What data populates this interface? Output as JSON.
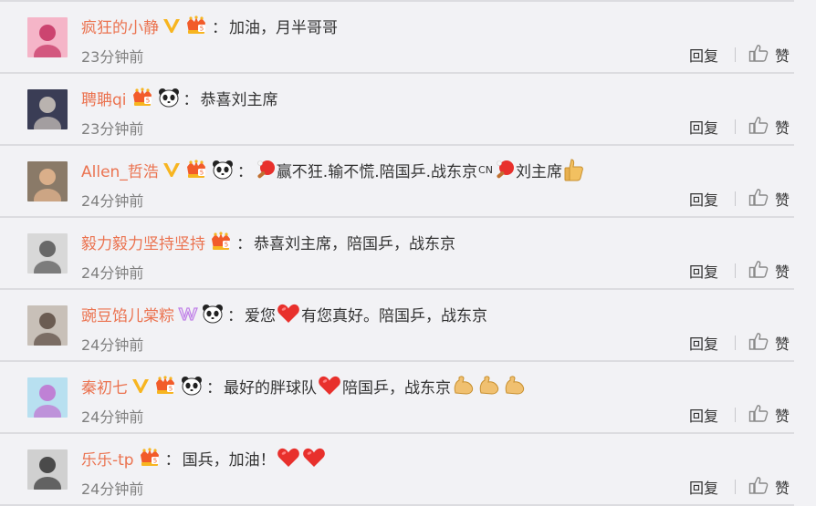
{
  "comments": [
    {
      "name": "疯狂的小静",
      "badges": [
        "v-gold",
        "crown"
      ],
      "parts": [
        {
          "t": "text",
          "v": "加油，月半哥哥"
        }
      ],
      "time": "23分钟前",
      "avatar": {
        "bg": "#f5b5c8",
        "fg": "#c43060"
      }
    },
    {
      "name": "聘聃qi",
      "badges": [
        "crown",
        "panda"
      ],
      "parts": [
        {
          "t": "text",
          "v": "恭喜刘主席"
        }
      ],
      "time": "23分钟前",
      "avatar": {
        "bg": "#3a3d55",
        "fg": "#d0c8c0"
      }
    },
    {
      "name": "Allen_哲浩",
      "badges": [
        "v-gold",
        "crown",
        "panda"
      ],
      "parts": [
        {
          "t": "icon",
          "v": "pingpong-icon"
        },
        {
          "t": "text",
          "v": "赢不狂.输不慌.陪国乒.战东京"
        },
        {
          "t": "text",
          "v": "CN",
          "small": true
        },
        {
          "t": "icon",
          "v": "pingpong-icon"
        },
        {
          "t": "text",
          "v": "刘主席"
        },
        {
          "t": "icon",
          "v": "thumbs-up-emoji-icon"
        }
      ],
      "time": "24分钟前",
      "avatar": {
        "bg": "#8a7a68",
        "fg": "#e8b890"
      }
    },
    {
      "name": "毅力毅力坚持坚持",
      "badges": [
        "crown"
      ],
      "parts": [
        {
          "t": "text",
          "v": "恭喜刘主席，陪国乒，战东京"
        }
      ],
      "time": "24分钟前",
      "avatar": {
        "bg": "#d8d8d8",
        "fg": "#555555"
      }
    },
    {
      "name": "豌豆馅儿棠粽",
      "badges": [
        "w-purple",
        "panda"
      ],
      "parts": [
        {
          "t": "text",
          "v": "爱您"
        },
        {
          "t": "icon",
          "v": "heart-icon"
        },
        {
          "t": "text",
          "v": "有您真好。陪国乒，战东京"
        }
      ],
      "time": "24分钟前",
      "avatar": {
        "bg": "#c8c0b8",
        "fg": "#5a4a40"
      }
    },
    {
      "name": "秦初七",
      "badges": [
        "v-gold",
        "crown",
        "panda"
      ],
      "parts": [
        {
          "t": "text",
          "v": "最好的胖球队"
        },
        {
          "t": "icon",
          "v": "heart-icon"
        },
        {
          "t": "text",
          "v": "陪国乒，战东京"
        },
        {
          "t": "icon",
          "v": "muscle-icon"
        },
        {
          "t": "icon",
          "v": "muscle-icon"
        },
        {
          "t": "icon",
          "v": "muscle-icon"
        }
      ],
      "time": "24分钟前",
      "avatar": {
        "bg": "#b8e0f0",
        "fg": "#c070d0"
      }
    },
    {
      "name": "乐乐-tp",
      "badges": [
        "crown"
      ],
      "parts": [
        {
          "t": "text",
          "v": "国兵，加油！"
        },
        {
          "t": "icon",
          "v": "heart-icon"
        },
        {
          "t": "icon",
          "v": "heart-icon"
        }
      ],
      "time": "24分钟前",
      "avatar": {
        "bg": "#d0d0d0",
        "fg": "#333333"
      }
    }
  ],
  "reply_label": "回复",
  "like_label": "赞",
  "colors": {
    "name": "#eb7350",
    "gold": "#f7b520",
    "crown": "#f25b2a",
    "heart": "#e8302c",
    "wpurple": "#c080e8"
  }
}
